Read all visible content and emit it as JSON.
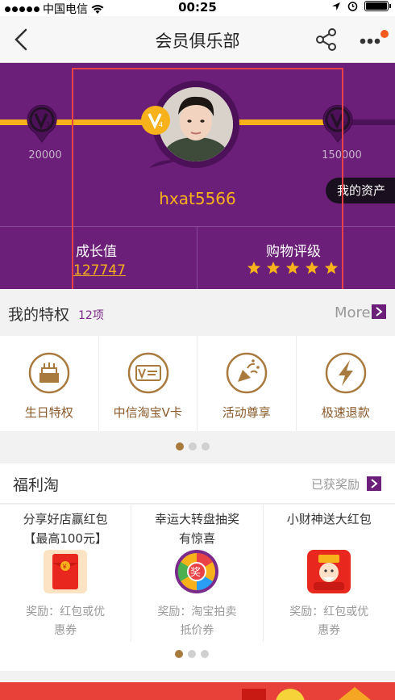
{
  "status_bar": {
    "carrier": "中国电信",
    "time": "00:25"
  },
  "nav": {
    "title": "会员俱乐部"
  },
  "profile": {
    "levels": [
      {
        "badge": "V3",
        "points": "20000"
      },
      {
        "badge": "V4"
      },
      {
        "badge": "V5",
        "points": "150000"
      }
    ],
    "username": "hxat5566",
    "assets_button": "我的资产",
    "growth_label": "成长值",
    "growth_value": "127747",
    "rating_label": "购物评级",
    "rating_stars": 5
  },
  "privileges": {
    "title": "我的特权",
    "count": "12项",
    "more": "More",
    "items": [
      {
        "label": "生日特权",
        "icon": "birthday-cake-icon"
      },
      {
        "label": "中信淘宝V卡",
        "icon": "v-card-icon"
      },
      {
        "label": "活动尊享",
        "icon": "party-popper-icon"
      },
      {
        "label": "极速退款",
        "icon": "lightning-icon"
      }
    ]
  },
  "fuli": {
    "title": "福利淘",
    "obtained": "已获奖励",
    "items": [
      {
        "title": "分享好店赢红包\n【最高100元】",
        "reward": "奖励：红包或优\n惠券",
        "icon": "red-envelope-icon"
      },
      {
        "title": "幸运大转盘抽奖\n有惊喜",
        "reward": "奖励：淘宝拍卖\n抵价券",
        "icon": "prize-wheel-icon"
      },
      {
        "title": "小财神送大红包",
        "reward": "奖励：红包或优\n惠券",
        "icon": "fortune-god-icon"
      }
    ]
  },
  "colors": {
    "purple": "#6b1f78",
    "gold": "#f7b21b",
    "brown": "#a87a3e",
    "highlight": "#e84246"
  }
}
